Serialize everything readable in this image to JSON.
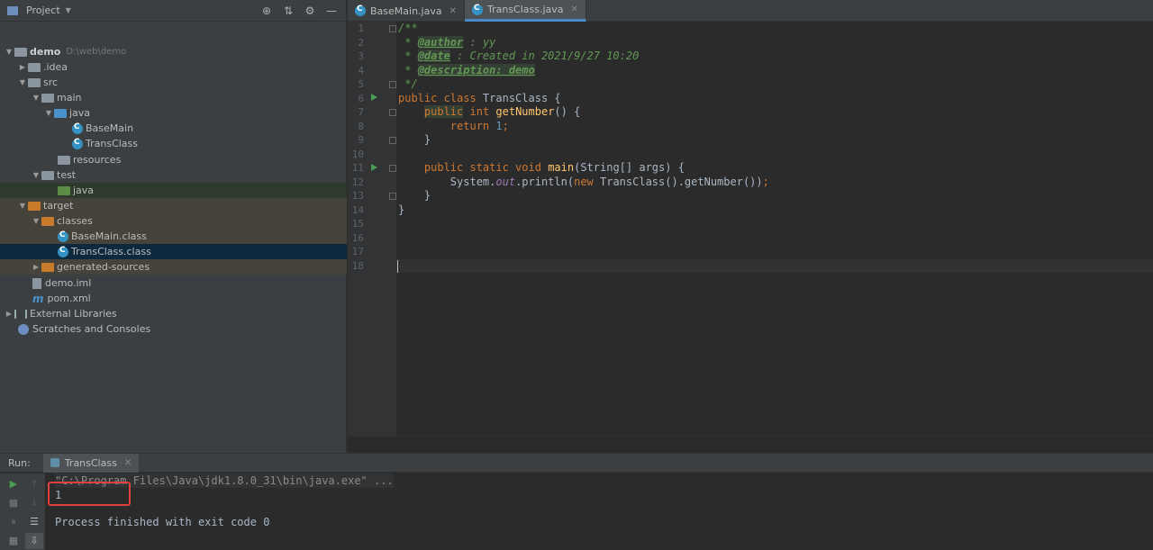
{
  "project_panel": {
    "title": "Project",
    "tree": [
      {
        "label": "demo",
        "path": "D:\\web\\demo"
      },
      {
        "label": ".idea"
      },
      {
        "label": "src"
      },
      {
        "label": "main"
      },
      {
        "label": "java"
      },
      {
        "label": "BaseMain"
      },
      {
        "label": "TransClass"
      },
      {
        "label": "resources"
      },
      {
        "label": "test"
      },
      {
        "label": "java"
      },
      {
        "label": "target"
      },
      {
        "label": "classes"
      },
      {
        "label": "BaseMain.class"
      },
      {
        "label": "TransClass.class"
      },
      {
        "label": "generated-sources"
      },
      {
        "label": "demo.iml"
      },
      {
        "label": "pom.xml"
      },
      {
        "label": "External Libraries"
      },
      {
        "label": "Scratches and Consoles"
      }
    ]
  },
  "editor": {
    "tabs": [
      {
        "label": "BaseMain.java"
      },
      {
        "label": "TransClass.java"
      }
    ],
    "line_numbers": [
      "1",
      "2",
      "3",
      "4",
      "5",
      "6",
      "7",
      "8",
      "9",
      "10",
      "11",
      "12",
      "13",
      "14",
      "15",
      "16",
      "17",
      "18"
    ],
    "code": {
      "l1": "/**",
      "l2_pre": " * ",
      "l2_tag": "@author",
      "l2_val": " : yy",
      "l3_pre": " * ",
      "l3_tag": "@date",
      "l3_val": " : Created in 2021/9/27 10:20",
      "l4_pre": " * ",
      "l4_tag": "@description: demo",
      "l5": " */",
      "l6_kw": "public class ",
      "l6_rest": "TransClass {",
      "l7_ind": "    ",
      "l7_kw1": "public",
      "l7_kw2": " int ",
      "l7_fn": "getNumber",
      "l7_rest": "() {",
      "l8_ind": "        ",
      "l8_kw": "return ",
      "l8_num": "1",
      "l8_semi": ";",
      "l9": "    }",
      "l11_ind": "    ",
      "l11_kw": "public static void ",
      "l11_fn": "main",
      "l11_rest": "(String[] args) {",
      "l12_ind": "        System.",
      "l12_fld": "out",
      "l12_mid": ".println(",
      "l12_kw": "new ",
      "l12_rest": "TransClass().getNumber())",
      "l12_semi": ";",
      "l13": "    }",
      "l14": "}"
    }
  },
  "run_panel": {
    "run_label": "Run:",
    "tab_label": "TransClass",
    "console": {
      "cmd": "\"C:\\Program Files\\Java\\jdk1.8.0_31\\bin\\java.exe\" ...",
      "output": "1",
      "finished": "Process finished with exit code 0"
    }
  },
  "colors": {
    "accent": "#4a88c7",
    "annotation_box": "#e0403d",
    "run_green": "#499c54"
  }
}
